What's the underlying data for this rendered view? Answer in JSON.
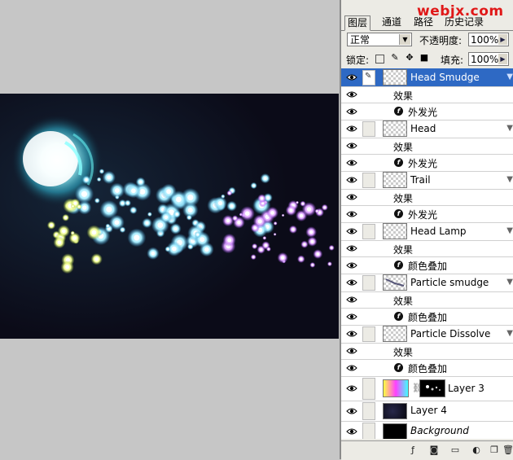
{
  "watermark": "webjx.com",
  "tabs": [
    "图层",
    "通道",
    "路径",
    "历史记录"
  ],
  "blend_mode": "正常",
  "opacity_label": "不透明度:",
  "opacity_value": "100%",
  "lock_label": "锁定:",
  "fill_label": "填充:",
  "fill_value": "100%",
  "layers": [
    {
      "name": "Head Smudge",
      "selected": true
    },
    {
      "effect": "效果"
    },
    {
      "sub": "外发光"
    },
    {
      "name": "Head"
    },
    {
      "effect": "效果"
    },
    {
      "sub": "外发光"
    },
    {
      "name": "Trail"
    },
    {
      "effect": "效果"
    },
    {
      "sub": "外发光"
    },
    {
      "name": "Head Lamp"
    },
    {
      "effect": "效果"
    },
    {
      "sub": "颜色叠加"
    },
    {
      "name": "Particle smudge"
    },
    {
      "effect": "效果"
    },
    {
      "sub": "颜色叠加"
    },
    {
      "name": "Particle Dissolve"
    },
    {
      "effect": "效果"
    },
    {
      "sub": "颜色叠加"
    },
    {
      "name": "Layer 3"
    },
    {
      "name": "Layer 4"
    },
    {
      "name": "Background"
    }
  ],
  "icons": [
    "eye-icon",
    "brush-icon",
    "link-icon",
    "fx-icon",
    "trash-icon"
  ]
}
